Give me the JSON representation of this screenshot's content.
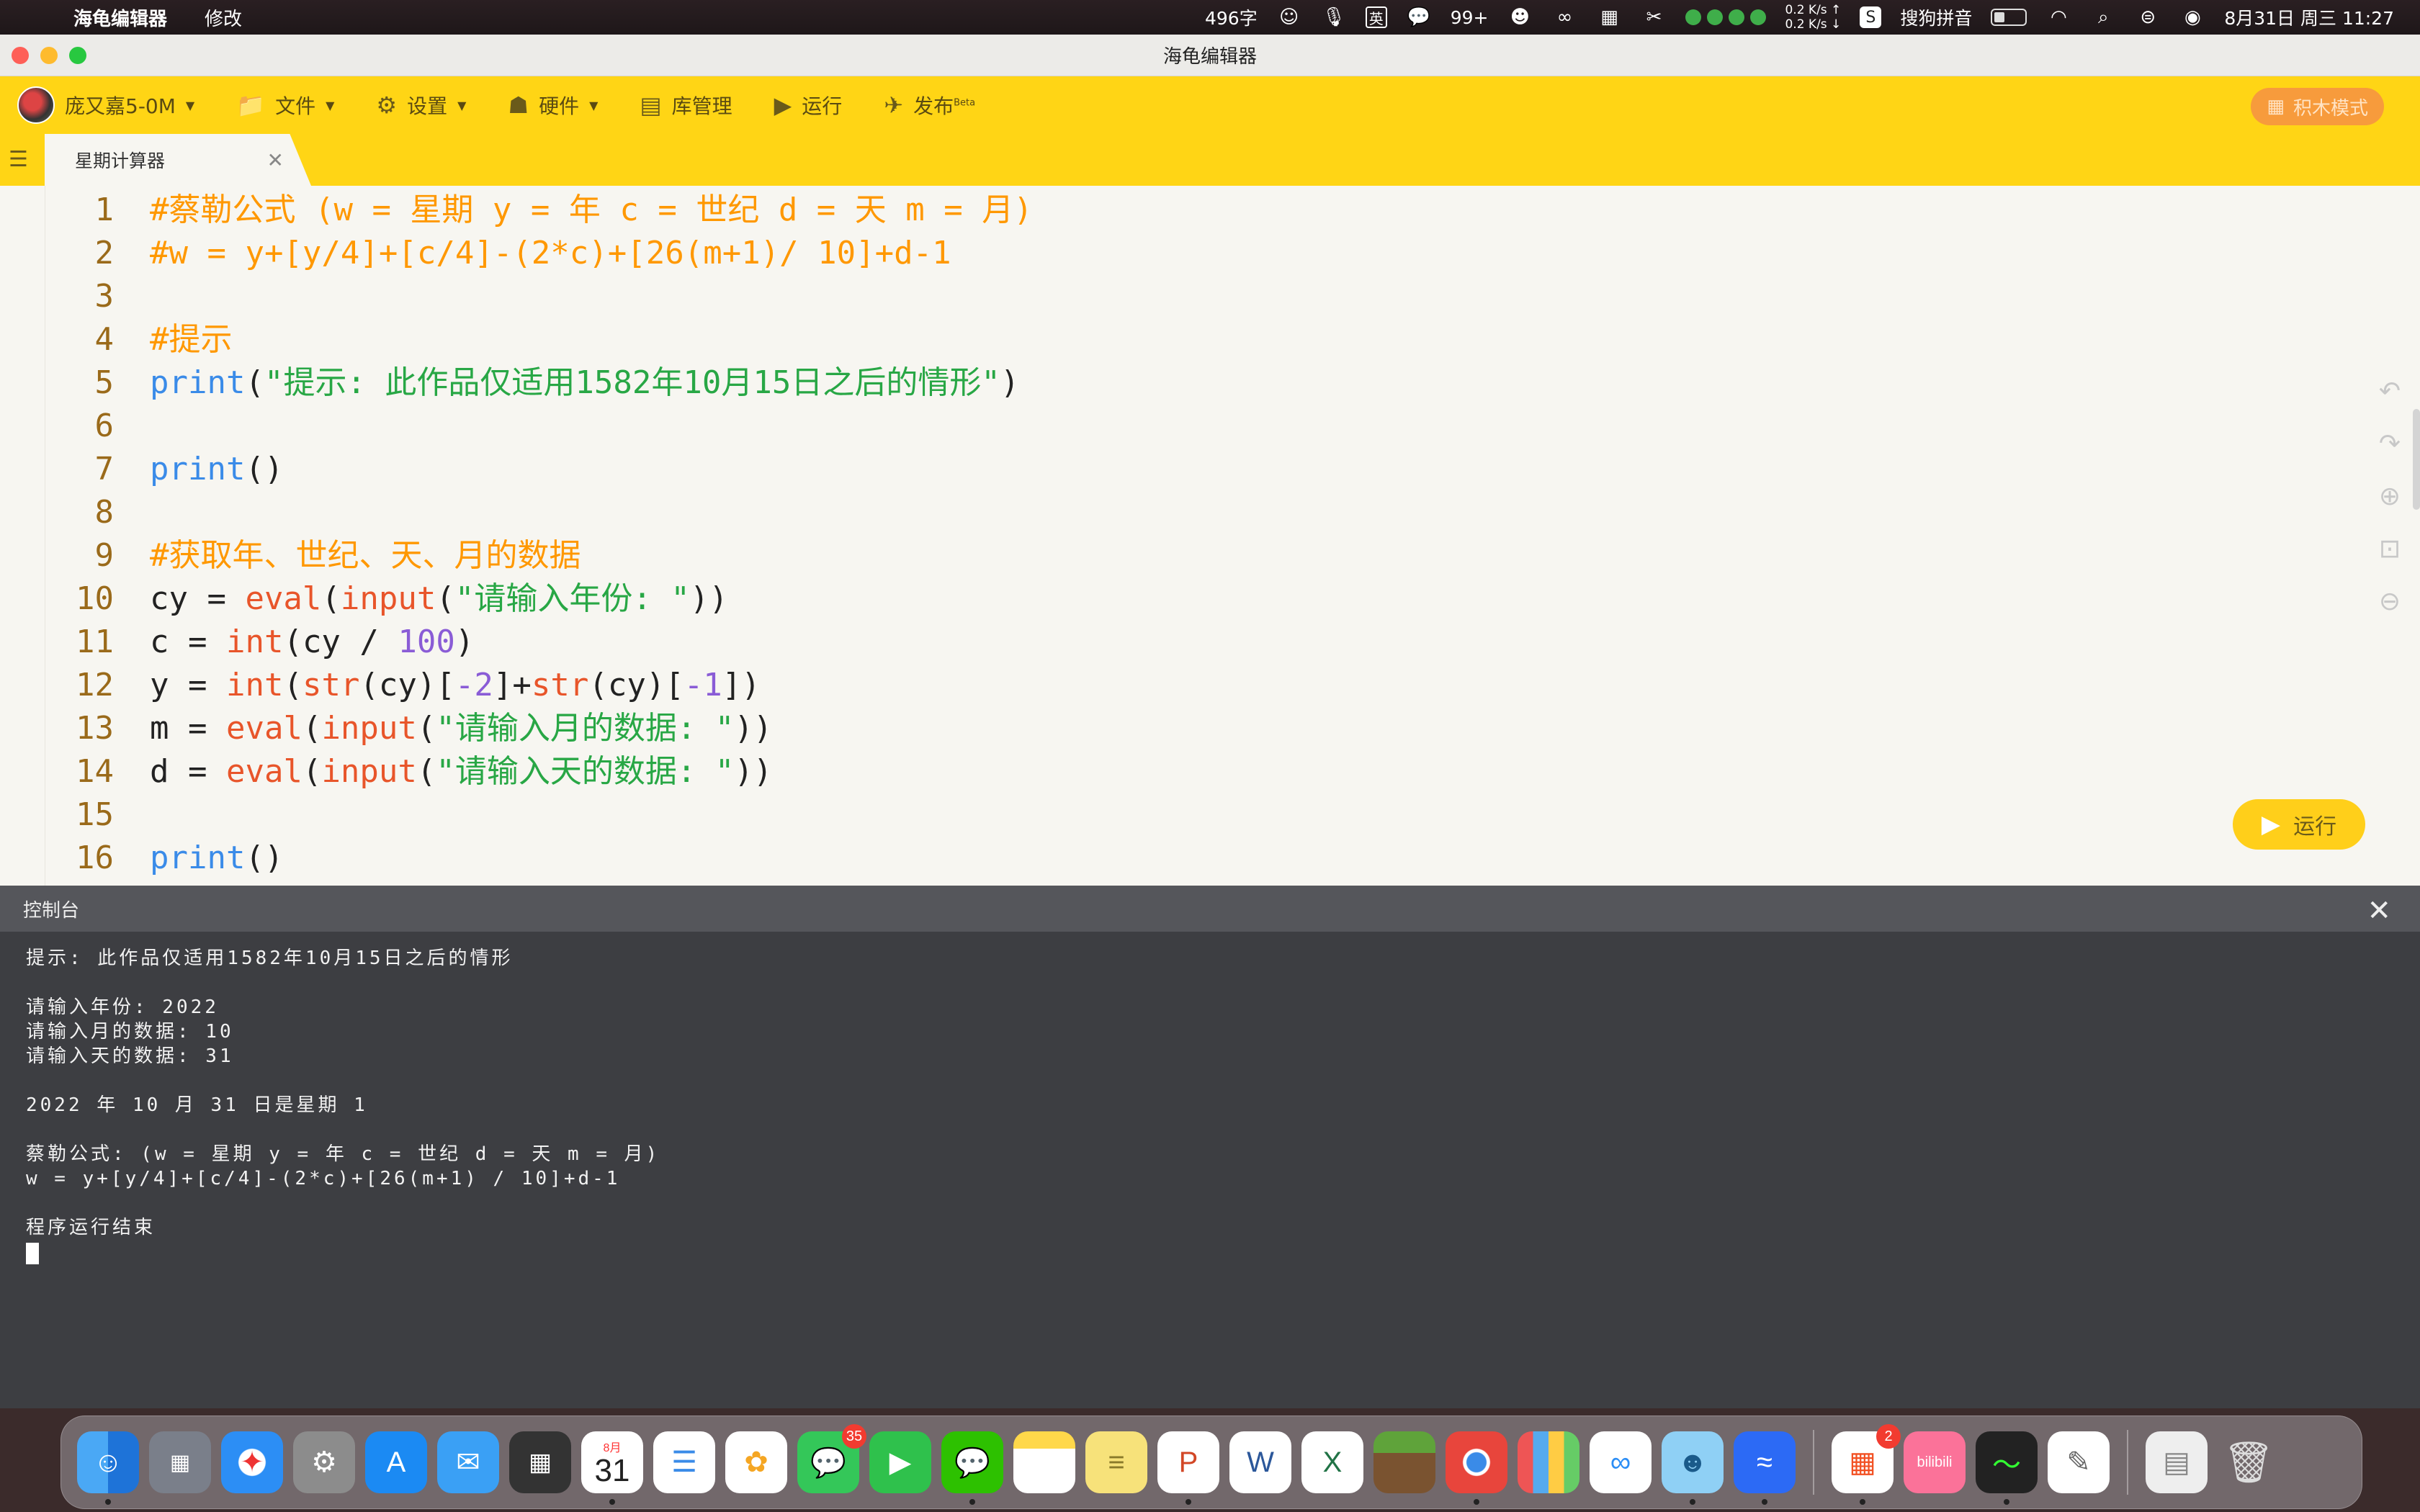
{
  "menubar": {
    "app_name": "海龟编辑器",
    "menu_edit": "修改",
    "char_count": "496字",
    "wechat_count": "99+",
    "net_up": "0.2 K/s ↑",
    "net_down": "0.2 K/s ↓",
    "ime": "搜狗拼音",
    "ime_lang": "英",
    "datetime": "8月31日 周三  11:27"
  },
  "window": {
    "title": "海龟编辑器"
  },
  "toolbar": {
    "user": "庞又嘉5-0M",
    "file": "文件",
    "settings": "设置",
    "hardware": "硬件",
    "library": "库管理",
    "run": "运行",
    "publish": "发布",
    "publish_tag": "Beta",
    "block_mode": "积木模式"
  },
  "tab": {
    "title": "星期计算器"
  },
  "editor": {
    "lines": [
      {
        "n": "1",
        "parts": [
          [
            "com",
            "#蔡勒公式 (w = 星期 y = 年 c = 世纪 d = 天 m = 月)"
          ]
        ]
      },
      {
        "n": "2",
        "parts": [
          [
            "com",
            "#w = y+[y/4]+[c/4]-(2*c)+[26(m+1)/ 10]+d-1"
          ]
        ]
      },
      {
        "n": "3",
        "parts": []
      },
      {
        "n": "4",
        "parts": [
          [
            "com",
            "#提示"
          ]
        ]
      },
      {
        "n": "5",
        "parts": [
          [
            "fn",
            "print"
          ],
          [
            "plain",
            "("
          ],
          [
            "str",
            "\"提示: 此作品仅适用1582年10月15日之后的情形\""
          ],
          [
            "plain",
            ")"
          ]
        ]
      },
      {
        "n": "6",
        "parts": []
      },
      {
        "n": "7",
        "parts": [
          [
            "fn",
            "print"
          ],
          [
            "plain",
            "()"
          ]
        ]
      },
      {
        "n": "8",
        "parts": []
      },
      {
        "n": "9",
        "parts": [
          [
            "com",
            "#获取年、世纪、天、月的数据"
          ]
        ]
      },
      {
        "n": "10",
        "parts": [
          [
            "plain",
            "cy = "
          ],
          [
            "kw",
            "eval"
          ],
          [
            "plain",
            "("
          ],
          [
            "kw",
            "input"
          ],
          [
            "plain",
            "("
          ],
          [
            "str",
            "\"请输入年份: \""
          ],
          [
            "plain",
            "))"
          ]
        ]
      },
      {
        "n": "11",
        "parts": [
          [
            "plain",
            "c = "
          ],
          [
            "kw",
            "int"
          ],
          [
            "plain",
            "(cy / "
          ],
          [
            "num",
            "100"
          ],
          [
            "plain",
            ")"
          ]
        ]
      },
      {
        "n": "12",
        "parts": [
          [
            "plain",
            "y = "
          ],
          [
            "kw",
            "int"
          ],
          [
            "plain",
            "("
          ],
          [
            "kw",
            "str"
          ],
          [
            "plain",
            "(cy)["
          ],
          [
            "num",
            "-2"
          ],
          [
            "plain",
            "]+"
          ],
          [
            "kw",
            "str"
          ],
          [
            "plain",
            "(cy)["
          ],
          [
            "num",
            "-1"
          ],
          [
            "plain",
            "])"
          ]
        ]
      },
      {
        "n": "13",
        "parts": [
          [
            "plain",
            "m = "
          ],
          [
            "kw",
            "eval"
          ],
          [
            "plain",
            "("
          ],
          [
            "kw",
            "input"
          ],
          [
            "plain",
            "("
          ],
          [
            "str",
            "\"请输入月的数据: \""
          ],
          [
            "plain",
            "))"
          ]
        ]
      },
      {
        "n": "14",
        "parts": [
          [
            "plain",
            "d = "
          ],
          [
            "kw",
            "eval"
          ],
          [
            "plain",
            "("
          ],
          [
            "kw",
            "input"
          ],
          [
            "plain",
            "("
          ],
          [
            "str",
            "\"请输入天的数据: \""
          ],
          [
            "plain",
            "))"
          ]
        ]
      },
      {
        "n": "15",
        "parts": []
      },
      {
        "n": "16",
        "parts": [
          [
            "fn",
            "print"
          ],
          [
            "plain",
            "()"
          ]
        ]
      }
    ],
    "run_button": "运行"
  },
  "console": {
    "title": "控制台",
    "lines": [
      "提示: 此作品仅适用1582年10月15日之后的情形",
      "",
      "请输入年份: 2022",
      "请输入月的数据: 10",
      "请输入天的数据: 31",
      "",
      "2022 年 10 月 31 日是星期 1",
      "",
      "蔡勒公式: (w = 星期 y = 年 c = 世纪 d = 天 m = 月)",
      "w = y+[y/4]+[c/4]-(2*c)+[26(m+1) / 10]+d-1",
      "",
      "程序运行结束"
    ]
  },
  "dock": {
    "calendar_month": "8月",
    "calendar_day": "31",
    "messages_badge": "35",
    "store_badge": "2",
    "bilibili": "bilibili"
  },
  "colors": {
    "toolbar": "#ffd515",
    "comment": "#ff9800",
    "function": "#3a8be8",
    "string": "#28a745",
    "keyword": "#e8552a",
    "number": "#8a5cd6",
    "console_bg": "#3d3e42"
  }
}
